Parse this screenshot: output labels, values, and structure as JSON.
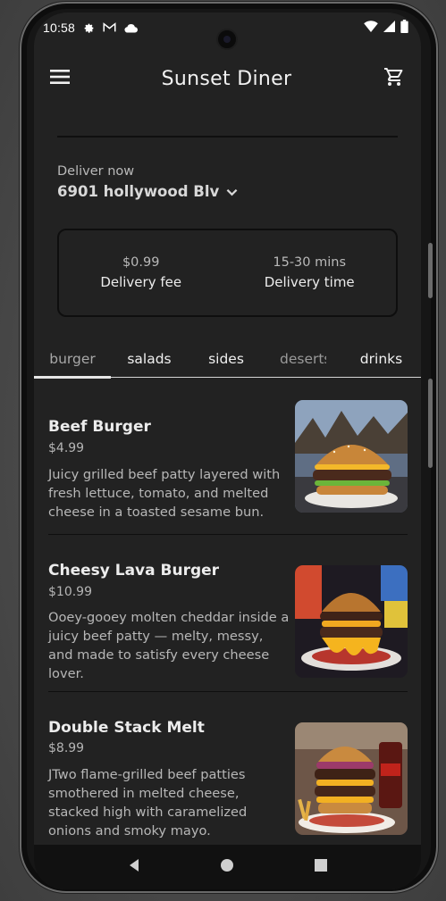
{
  "status": {
    "time": "10:58"
  },
  "app": {
    "title": "Sunset Diner"
  },
  "deliver": {
    "label": "Deliver now",
    "address": "6901 hollywood Blv"
  },
  "delivery_info": {
    "fee_value": "$0.99",
    "fee_label": "Delivery fee",
    "time_value": "15-30 mins",
    "time_label": "Delivery time"
  },
  "tabs": [
    {
      "label": "burger"
    },
    {
      "label": "salads"
    },
    {
      "label": "sides"
    },
    {
      "label": "deserts"
    },
    {
      "label": "drinks"
    }
  ],
  "items": [
    {
      "name": "Beef Burger",
      "price": "$4.99",
      "desc": "Juicy grilled beef patty layered with fresh lettuce, tomato, and melted cheese in a toasted sesame bun."
    },
    {
      "name": "Cheesy Lava Burger",
      "price": "$10.99",
      "desc": "Ooey-gooey molten cheddar inside a juicy beef patty — melty, messy, and made to satisfy every cheese lover."
    },
    {
      "name": "Double Stack Melt",
      "price": "$8.99",
      "desc": "JTwo flame-grilled beef patties smothered in melted cheese, stacked high with caramelized onions and smoky mayo."
    }
  ],
  "icons": {
    "menu": "menu-icon",
    "cart": "cart-icon",
    "chevron": "chevron-down-icon",
    "back": "back-icon",
    "home": "home-icon",
    "recents": "recents-icon"
  }
}
